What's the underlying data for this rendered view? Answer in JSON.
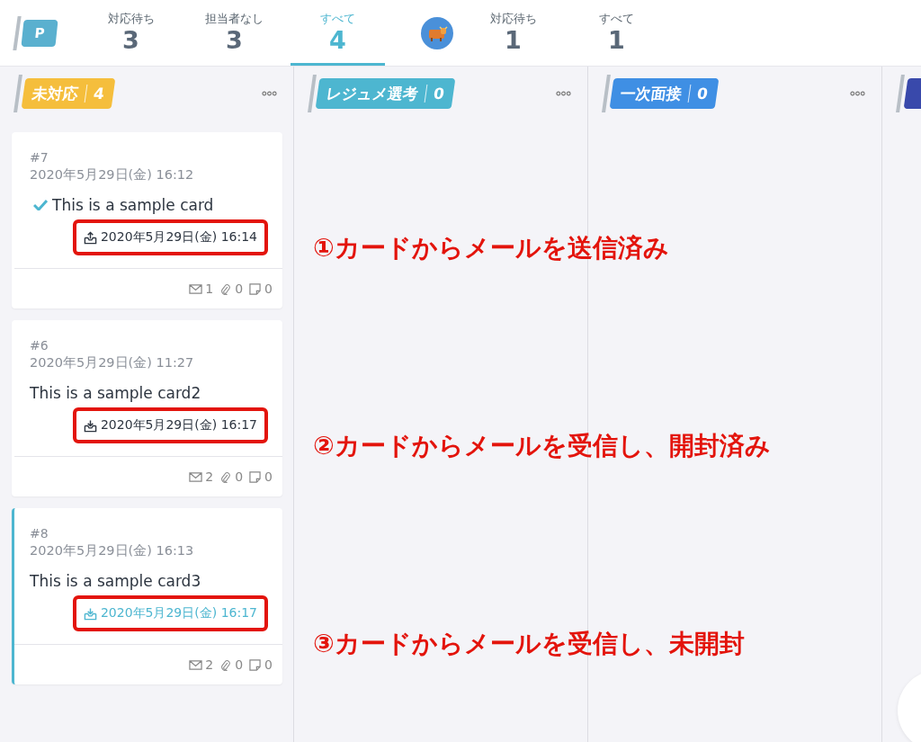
{
  "header": {
    "logo": "P",
    "tabs": [
      {
        "label": "対応待ち",
        "count": "3",
        "selected": false
      },
      {
        "label": "担当者なし",
        "count": "3",
        "selected": false
      },
      {
        "label": "すべて",
        "count": "4",
        "selected": true
      },
      {
        "kind": "avatar"
      },
      {
        "label": "対応待ち",
        "count": "1",
        "selected": false
      },
      {
        "label": "すべて",
        "count": "1",
        "selected": false
      }
    ]
  },
  "columns": [
    {
      "label": "未対応",
      "count": "4",
      "color": "#f5be3c",
      "cards": [
        {
          "number": "#7",
          "created": "2020年5月29日(金) 16:12",
          "title": "This is a sample card",
          "done": true,
          "unread": false,
          "mail": {
            "kind": "sent",
            "time": "2020年5月29日(金) 16:14",
            "highlighted": true
          },
          "counts": {
            "mails": "1",
            "attachments": "0",
            "notes": "0"
          }
        },
        {
          "number": "#6",
          "created": "2020年5月29日(金) 11:27",
          "title": "This is a sample card2",
          "done": false,
          "unread": false,
          "mail": {
            "kind": "received",
            "time": "2020年5月29日(金) 16:17",
            "highlighted": true
          },
          "counts": {
            "mails": "2",
            "attachments": "0",
            "notes": "0"
          }
        },
        {
          "number": "#8",
          "created": "2020年5月29日(金) 16:13",
          "title": "This is a sample card3",
          "done": false,
          "unread": true,
          "mail": {
            "kind": "received",
            "time": "2020年5月29日(金) 16:17",
            "highlighted": true
          },
          "counts": {
            "mails": "2",
            "attachments": "0",
            "notes": "0"
          }
        }
      ]
    },
    {
      "label": "レジュメ選考",
      "count": "0",
      "color": "#4db6d0"
    },
    {
      "label": "一次面接",
      "count": "0",
      "color": "#3f8fe4"
    },
    {
      "color": "#3949ab"
    }
  ],
  "annotations": [
    "①カードからメールを送信済み",
    "②カードからメールを受信し、開封済み",
    "③カードからメールを受信し、未開封"
  ]
}
